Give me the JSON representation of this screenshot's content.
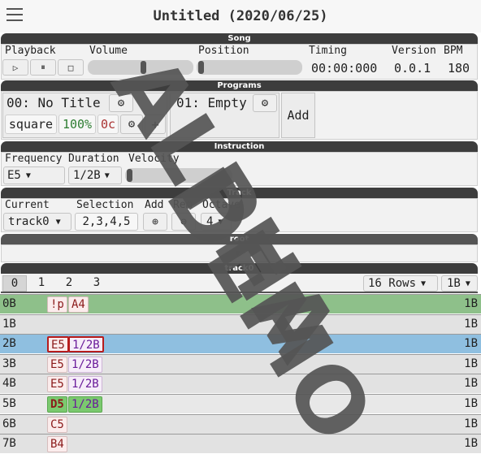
{
  "header": {
    "title": "Untitled (2020/06/25)",
    "menu_icon": "hamburger-menu-icon"
  },
  "song": {
    "section_label": "Song",
    "playback": {
      "label": "Playback",
      "buttons": [
        "play-icon",
        "pause-icon",
        "stop-icon"
      ]
    },
    "volume": {
      "label": "Volume",
      "level": 0.5
    },
    "position": {
      "label": "Position",
      "level": 0.0
    },
    "timing": {
      "label": "Timing",
      "value": "00:00:000"
    },
    "version": {
      "label": "Version",
      "value": "0.0.1"
    },
    "bpm": {
      "label": "BPM",
      "value": "180"
    }
  },
  "programs": {
    "section_label": "Programs",
    "program0": {
      "name": "00: No Title",
      "waveform": "square",
      "volume": "100%",
      "cents": "0c",
      "add_label": "+"
    },
    "program1": {
      "name": "01: Empty"
    },
    "add_label": "Add"
  },
  "instruction": {
    "section_label": "Instruction",
    "frequency": {
      "label": "Frequency",
      "value": "E5"
    },
    "duration": {
      "label": "Duration",
      "value": "1/2B"
    },
    "velocity": {
      "label": "Velocity",
      "level": 0.0
    }
  },
  "track": {
    "section_label": "Track",
    "current": {
      "label": "Current",
      "value": "track0"
    },
    "selection": {
      "label": "Selection",
      "value": "2,3,4,5"
    },
    "add": {
      "label": "Add",
      "icon": "plus-circle-icon"
    },
    "remove": {
      "label": "Rem",
      "icon": "minus-circle-icon"
    },
    "octave": {
      "label": "Octave",
      "value": "4"
    }
  },
  "root_section_label": "root",
  "track0": {
    "section_label": "track0",
    "tabs": [
      "0",
      "1",
      "2",
      "3"
    ],
    "active_tab": 0,
    "rows_select": "16 Rows",
    "beat_select": "1B",
    "rows": [
      {
        "index": "0B",
        "cells": [
          {
            "text": "!p",
            "kind": "note"
          },
          {
            "text": "A4",
            "kind": "note"
          }
        ],
        "length": "1B",
        "state": "playing"
      },
      {
        "index": "1B",
        "cells": [],
        "length": "1B",
        "state": "normal"
      },
      {
        "index": "2B",
        "cells": [
          {
            "text": "E5",
            "kind": "note"
          },
          {
            "text": "1/2B",
            "kind": "dur"
          }
        ],
        "length": "1B",
        "state": "cursor"
      },
      {
        "index": "3B",
        "cells": [
          {
            "text": "E5",
            "kind": "note"
          },
          {
            "text": "1/2B",
            "kind": "dur"
          }
        ],
        "length": "1B",
        "state": "normal"
      },
      {
        "index": "4B",
        "cells": [
          {
            "text": "E5",
            "kind": "note"
          },
          {
            "text": "1/2B",
            "kind": "dur"
          }
        ],
        "length": "1B",
        "state": "normal"
      },
      {
        "index": "5B",
        "cells": [
          {
            "text": "D5",
            "kind": "note"
          },
          {
            "text": "1/2B",
            "kind": "dur"
          }
        ],
        "length": "1B",
        "state": "highlight"
      },
      {
        "index": "6B",
        "cells": [
          {
            "text": "C5",
            "kind": "note"
          }
        ],
        "length": "1B",
        "state": "normal"
      },
      {
        "index": "7B",
        "cells": [
          {
            "text": "B4",
            "kind": "note"
          }
        ],
        "length": "1B",
        "state": "normal"
      }
    ]
  },
  "watermark": {
    "line1": "ALPHA",
    "line2": "DEMO"
  }
}
